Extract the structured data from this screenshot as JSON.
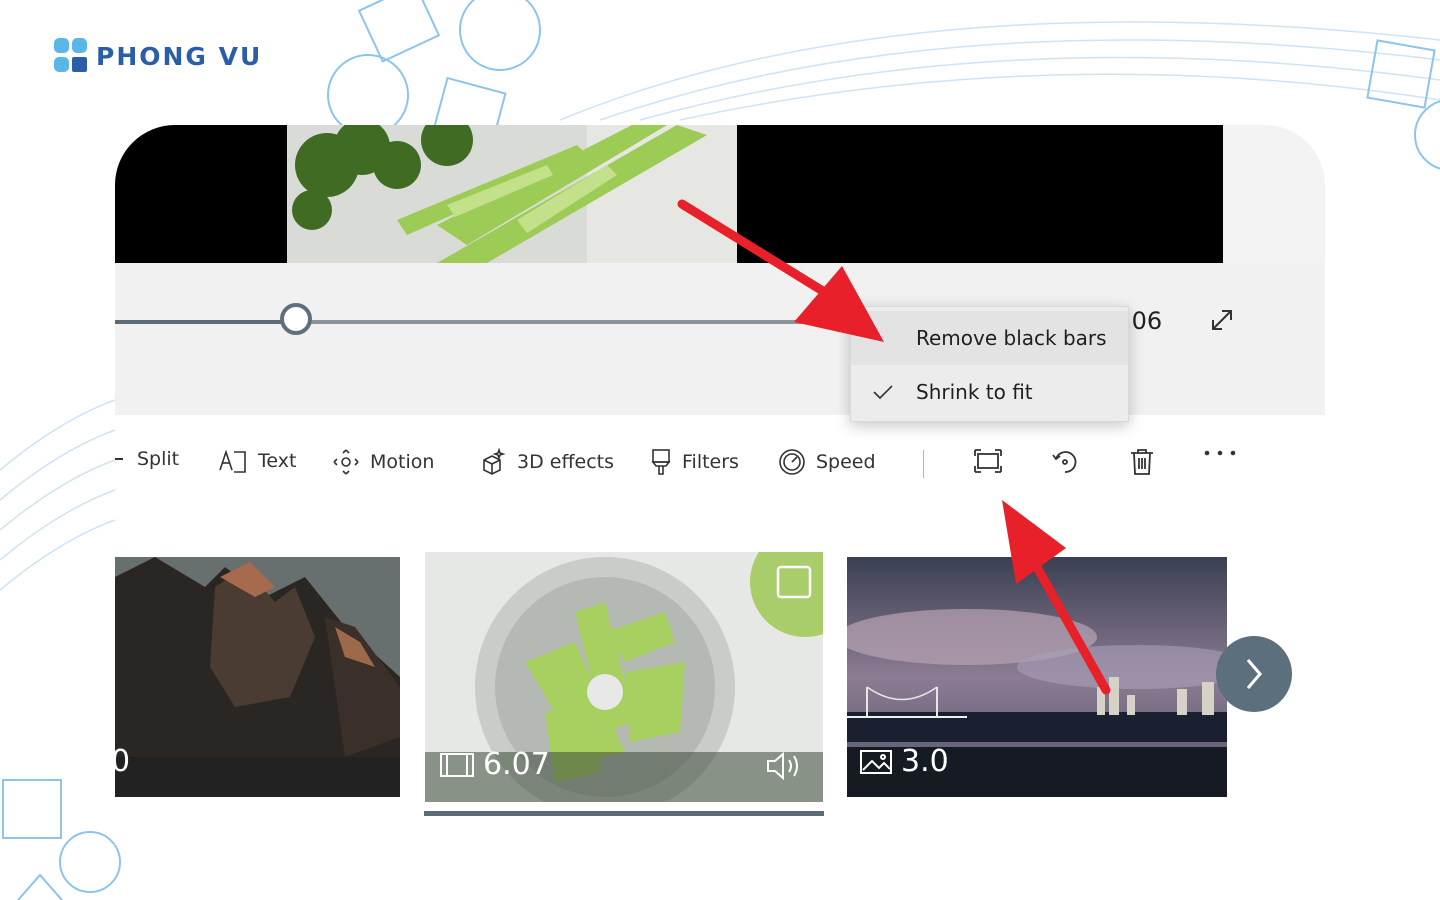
{
  "brand": {
    "name": "PHONG VU"
  },
  "player": {
    "time_display": ".06"
  },
  "context_menu": {
    "items": [
      {
        "label": "Remove black bars",
        "checked": false
      },
      {
        "label": "Shrink to fit",
        "checked": true
      }
    ]
  },
  "toolbar": {
    "split_label": "Split",
    "text_label": "Text",
    "motion_label": "Motion",
    "effects_label": "3D effects",
    "filters_label": "Filters",
    "speed_label": "Speed"
  },
  "storyboard": {
    "clips": [
      {
        "duration": "0",
        "kind": "image"
      },
      {
        "duration": "6.07",
        "kind": "video",
        "selected": true
      },
      {
        "duration": "3.0",
        "kind": "image"
      }
    ]
  },
  "colors": {
    "brand": "#2a5fa8",
    "brand_accent": "#59b6e6",
    "annotation_arrow": "#e8202a",
    "slider_thumb": "#5e6e7b",
    "next_button": "#5c6f7c"
  }
}
